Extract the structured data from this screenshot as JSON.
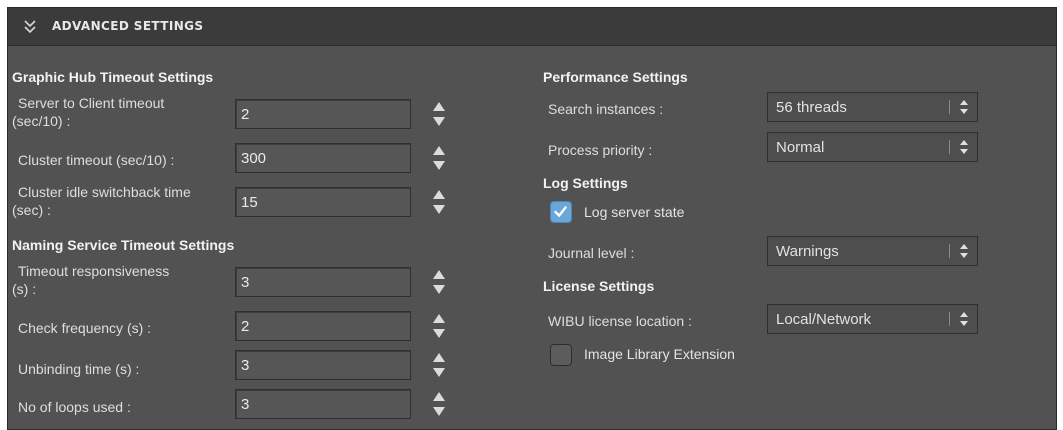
{
  "header": {
    "title": "ADVANCED SETTINGS",
    "icon": "double-chevron-down-icon"
  },
  "graphic_hub": {
    "title": "Graphic Hub Timeout Settings",
    "fields": [
      {
        "label_line1": "Server to Client timeout",
        "label_line2": "(sec/10) :",
        "value": "2"
      },
      {
        "label_line1": "Cluster timeout (sec/10) :",
        "label_line2": "",
        "value": "300"
      },
      {
        "label_line1": "Cluster idle switchback time",
        "label_line2": "(sec) :",
        "value": "15"
      }
    ]
  },
  "naming_service": {
    "title": "Naming Service Timeout Settings",
    "fields": [
      {
        "label_line1": "Timeout responsiveness",
        "label_line2": "(s) :",
        "value": "3"
      },
      {
        "label_line1": "Check frequency (s) :",
        "label_line2": "",
        "value": "2"
      },
      {
        "label_line1": "Unbinding time (s) :",
        "label_line2": "",
        "value": "3"
      },
      {
        "label_line1": "No of loops used :",
        "label_line2": "",
        "value": "3"
      }
    ]
  },
  "performance": {
    "title": "Performance Settings",
    "search_instances": {
      "label": "Search instances :",
      "value": "56 threads"
    },
    "process_priority": {
      "label": "Process priority :",
      "value": "Normal"
    }
  },
  "log": {
    "title": "Log Settings",
    "log_server_state": {
      "label": "Log server state",
      "checked": true
    },
    "journal_level": {
      "label": "Journal level :",
      "value": "Warnings"
    }
  },
  "license": {
    "title": "License Settings",
    "wibu_location": {
      "label": "WIBU license location :",
      "value": "Local/Network"
    },
    "image_library_extension": {
      "label": "Image Library Extension",
      "checked": false
    }
  },
  "colors": {
    "panel_bg": "#525252",
    "header_bg": "#3b3b3b",
    "accent": "#6aa6d8"
  }
}
